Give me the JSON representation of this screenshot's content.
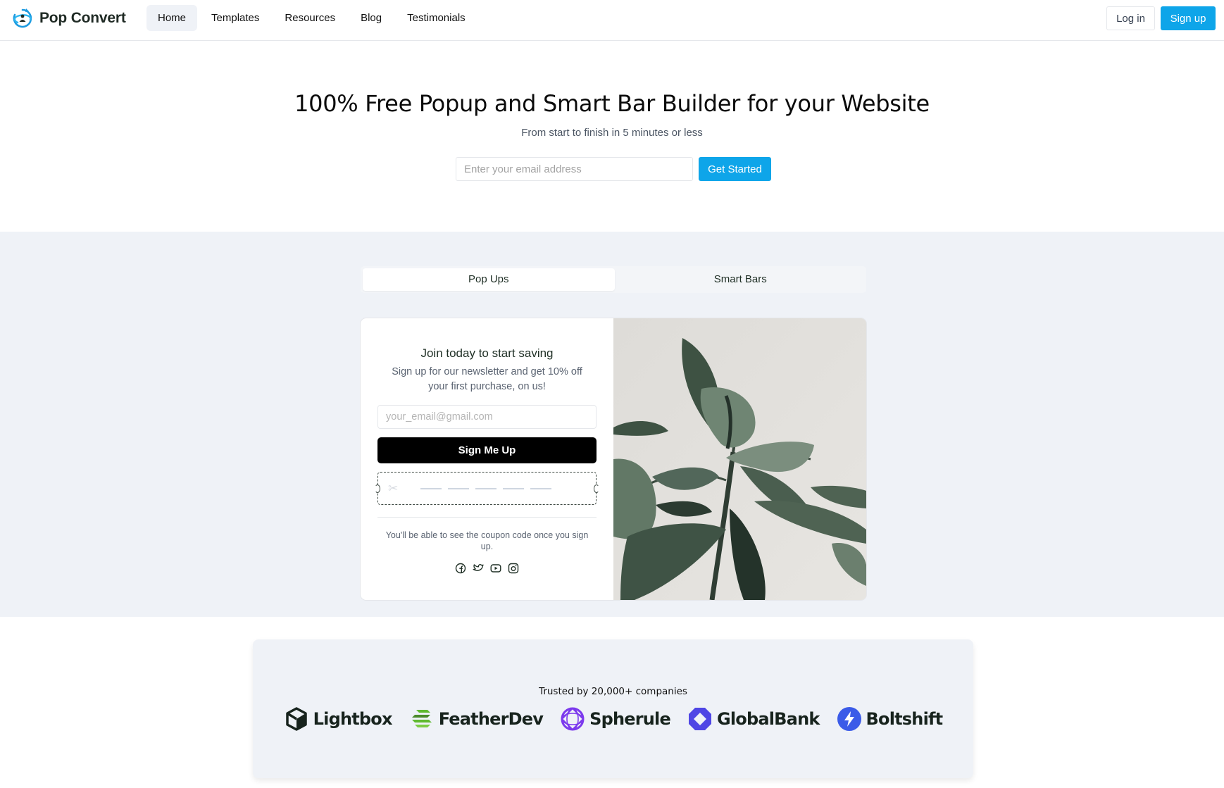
{
  "header": {
    "brand": "Pop Convert",
    "nav": [
      {
        "label": "Home",
        "active": true
      },
      {
        "label": "Templates",
        "active": false
      },
      {
        "label": "Resources",
        "active": false
      },
      {
        "label": "Blog",
        "active": false
      },
      {
        "label": "Testimonials",
        "active": false
      }
    ],
    "login_label": "Log in",
    "signup_label": "Sign up",
    "accent_color": "#0ea5e9"
  },
  "hero": {
    "title": "100% Free Popup and Smart Bar Builder for your Website",
    "subtitle": "From start to finish in 5 minutes or less",
    "email_placeholder": "Enter your email address",
    "email_value": "",
    "cta_label": "Get Started"
  },
  "showcase": {
    "tabs": [
      {
        "label": "Pop Ups",
        "active": true
      },
      {
        "label": "Smart Bars",
        "active": false
      }
    ],
    "popup": {
      "title": "Join today to start saving",
      "description": "Sign up for our newsletter and get 10% off your first purchase, on us!",
      "email_placeholder": "your_email@gmail.com",
      "email_value": "",
      "button_label": "Sign Me Up",
      "coupon_icon": "scissors-icon",
      "note": "You'll be able to see the coupon code once you sign up.",
      "socials": [
        "facebook-icon",
        "twitter-icon",
        "youtube-icon",
        "instagram-icon"
      ],
      "image": "rubber-plant-photo"
    }
  },
  "trust": {
    "text": "Trusted by 20,000+ companies",
    "brands": [
      {
        "name": "Lightbox",
        "icon": "cube-icon",
        "color": "#17231d"
      },
      {
        "name": "FeatherDev",
        "icon": "feather-stripes-icon",
        "color": "#5fb92f"
      },
      {
        "name": "Spherule",
        "icon": "sphere-icon",
        "color": "#7c3aed"
      },
      {
        "name": "GlobalBank",
        "icon": "octagon-icon",
        "color": "#4f46e5"
      },
      {
        "name": "Boltshift",
        "icon": "bolt-icon",
        "color": "#3b5be8"
      }
    ]
  }
}
